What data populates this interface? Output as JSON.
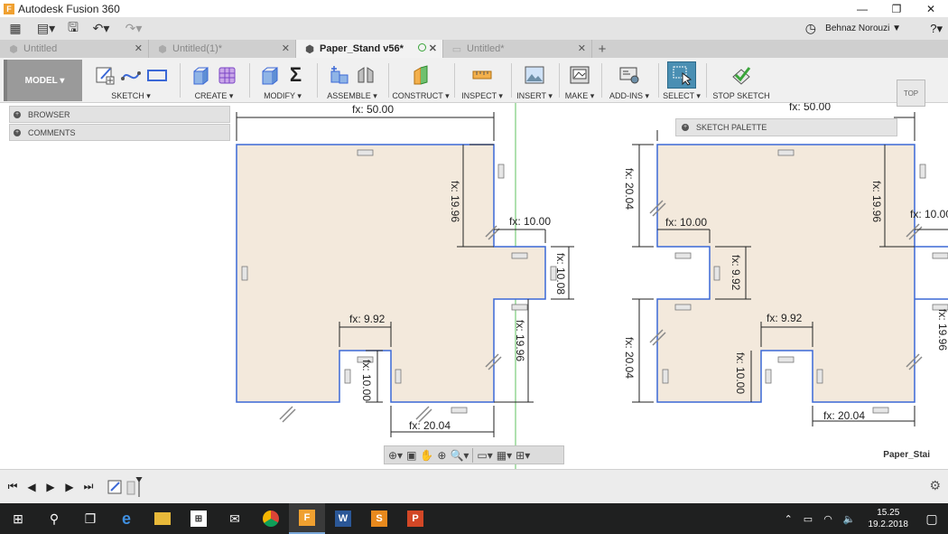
{
  "window": {
    "title": "Autodesk Fusion 360",
    "app_icon": "F"
  },
  "quick_access": {
    "user": "Behnaz Norouzi ▼",
    "help": "?▾"
  },
  "tabs": [
    {
      "label": "Untitled",
      "active": false
    },
    {
      "label": "Untitled(1)*",
      "active": false
    },
    {
      "label": "Paper_Stand v56*",
      "active": true
    },
    {
      "label": "Untitled*",
      "active": false
    }
  ],
  "toolbar": {
    "workspace": "MODEL ▾",
    "groups": [
      {
        "label": "SKETCH ▾"
      },
      {
        "label": "CREATE ▾"
      },
      {
        "label": "MODIFY ▾"
      },
      {
        "label": "ASSEMBLE ▾"
      },
      {
        "label": "CONSTRUCT ▾"
      },
      {
        "label": "INSPECT ▾"
      },
      {
        "label": "INSERT ▾"
      },
      {
        "label": "MAKE ▾"
      },
      {
        "label": "ADD-INS ▾"
      },
      {
        "label": "SELECT ▾"
      },
      {
        "label": "STOP SKETCH"
      }
    ]
  },
  "browser": {
    "browser_label": "BROWSER",
    "comments_label": "COMMENTS"
  },
  "sketch_palette": {
    "label": "SKETCH PALETTE"
  },
  "viewcube": {
    "label": "TOP"
  },
  "dimensions": {
    "left": {
      "width_top": "fx: 50.00",
      "height_right_upper": "fx: 19.96",
      "notch_width": "fx: 10.00",
      "notch_height": "fx: 10.08",
      "height_right_lower": "fx: 19.96",
      "slot_width": "fx: 9.92",
      "slot_height": "fx: 10.00",
      "width_bottom": "fx: 20.04"
    },
    "right": {
      "width_top": "fx: 50.00",
      "height_left_upper": "fx: 20.04",
      "notch_width": "fx: 10.00",
      "notch_height": "fx: 9.92",
      "height_left_lower": "fx: 20.04",
      "height_right_upper": "fx: 19.96",
      "edge_width": "fx: 10.00",
      "slot_width": "fx: 9.92",
      "slot_height": "fx: 10.00",
      "width_bottom": "fx: 20.04",
      "edge_lower": "fx: 19.96"
    }
  },
  "document_name": "Paper_Stai",
  "taskbar": {
    "time": "15.25",
    "date": "19.2.2018"
  },
  "colors": {
    "sketch_fill": "#f3e9dc",
    "sketch_line": "#3b68d6",
    "toolbar_bg": "#f0f0f0",
    "taskbar_bg": "#1f2020",
    "select_highlight": "#4a8fb3"
  }
}
